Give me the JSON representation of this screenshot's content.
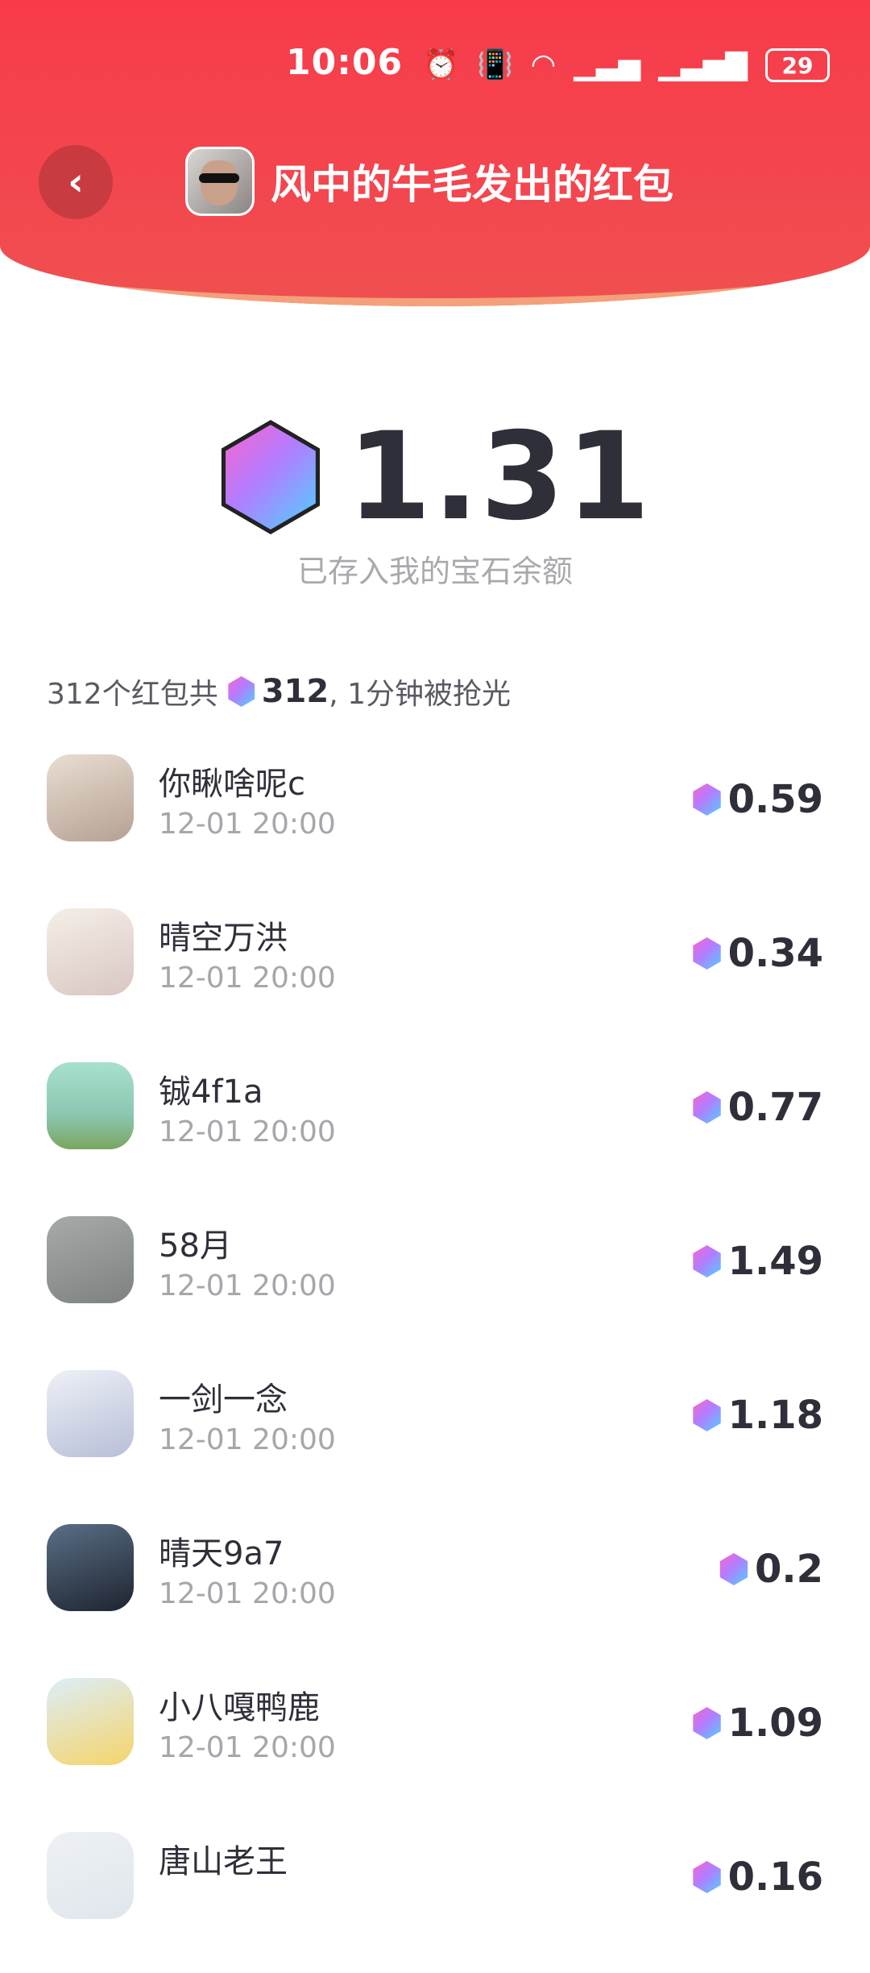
{
  "status": {
    "time": "10:06",
    "battery": "29",
    "icons": [
      "alarm-icon",
      "vibrate-icon",
      "wifi-icon",
      "signal-x-icon",
      "signal-5g-icon"
    ]
  },
  "header": {
    "back_icon": "chevron-left-icon",
    "title": "风中的牛毛发出的红包"
  },
  "amount": {
    "value": "1.31",
    "caption": "已存入我的宝石余额"
  },
  "summary": {
    "prefix": "312个红包共",
    "total": "312",
    "suffix": ", 1分钟被抢光"
  },
  "list": [
    {
      "name": "你瞅啥呢c",
      "time": "12-01 20:00",
      "amount": "0.59"
    },
    {
      "name": "晴空万洪",
      "time": "12-01 20:00",
      "amount": "0.34"
    },
    {
      "name": "铖4f1a",
      "time": "12-01 20:00",
      "amount": "0.77"
    },
    {
      "name": "58月",
      "time": "12-01 20:00",
      "amount": "1.49"
    },
    {
      "name": "一剑一念",
      "time": "12-01 20:00",
      "amount": "1.18"
    },
    {
      "name": "晴天9a7",
      "time": "12-01 20:00",
      "amount": "0.2"
    },
    {
      "name": "小八嘎鸭鹿",
      "time": "12-01 20:00",
      "amount": "1.09"
    },
    {
      "name": "唐山老王",
      "time": "",
      "amount": "0.16"
    }
  ],
  "colors": {
    "header_red": "#f83b4a",
    "gem_pink": "#ff63c7",
    "gem_blue": "#48d6ff"
  }
}
